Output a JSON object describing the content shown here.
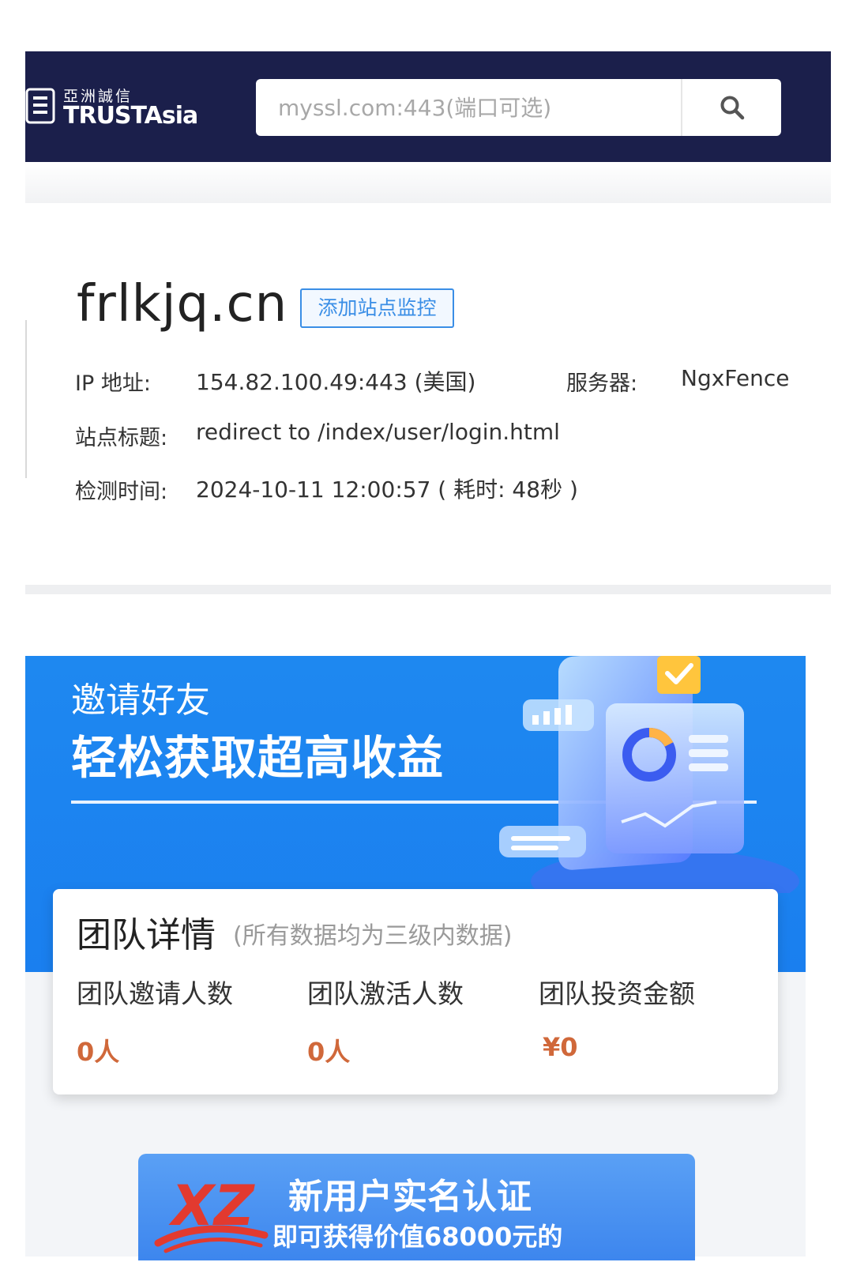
{
  "header": {
    "logo": {
      "cn_text": "亞洲誠信",
      "en_text": "TRUSTAsia"
    },
    "search": {
      "placeholder": "myssl.com:443(端口可选)",
      "button_icon": "search-icon"
    }
  },
  "site": {
    "domain": "frlkjq.cn",
    "monitor_button": "添加站点监控",
    "ip_label": "IP 地址:",
    "ip_value": "154.82.100.49:443 (美国)",
    "server_label": "服务器:",
    "server_value": "NgxFence",
    "title_label": "站点标题:",
    "title_value": "redirect to /index/user/login.html",
    "time_label": "检测时间:",
    "time_value": "2024-10-11 12:00:57 ( 耗时: 48秒 )"
  },
  "banner": {
    "line1": "邀请好友",
    "line2": "轻松获取超高收益"
  },
  "team": {
    "title": "团队详情",
    "subtitle": "(所有数据均为三级内数据)",
    "stats": [
      {
        "label": "团队邀请人数",
        "value": "0人"
      },
      {
        "label": "团队激活人数",
        "value": "0人"
      },
      {
        "label": "团队投资金额",
        "value": "¥0"
      }
    ]
  },
  "promo": {
    "logo_text": "XZ",
    "title": "新用户实名认证",
    "subtitle": "即可获得价值68000元的"
  },
  "colors": {
    "header_bg": "#1b1f4b",
    "link_blue": "#3a8ee6",
    "banner_blue": "#1e88f0",
    "stat_orange": "#d0683a"
  }
}
